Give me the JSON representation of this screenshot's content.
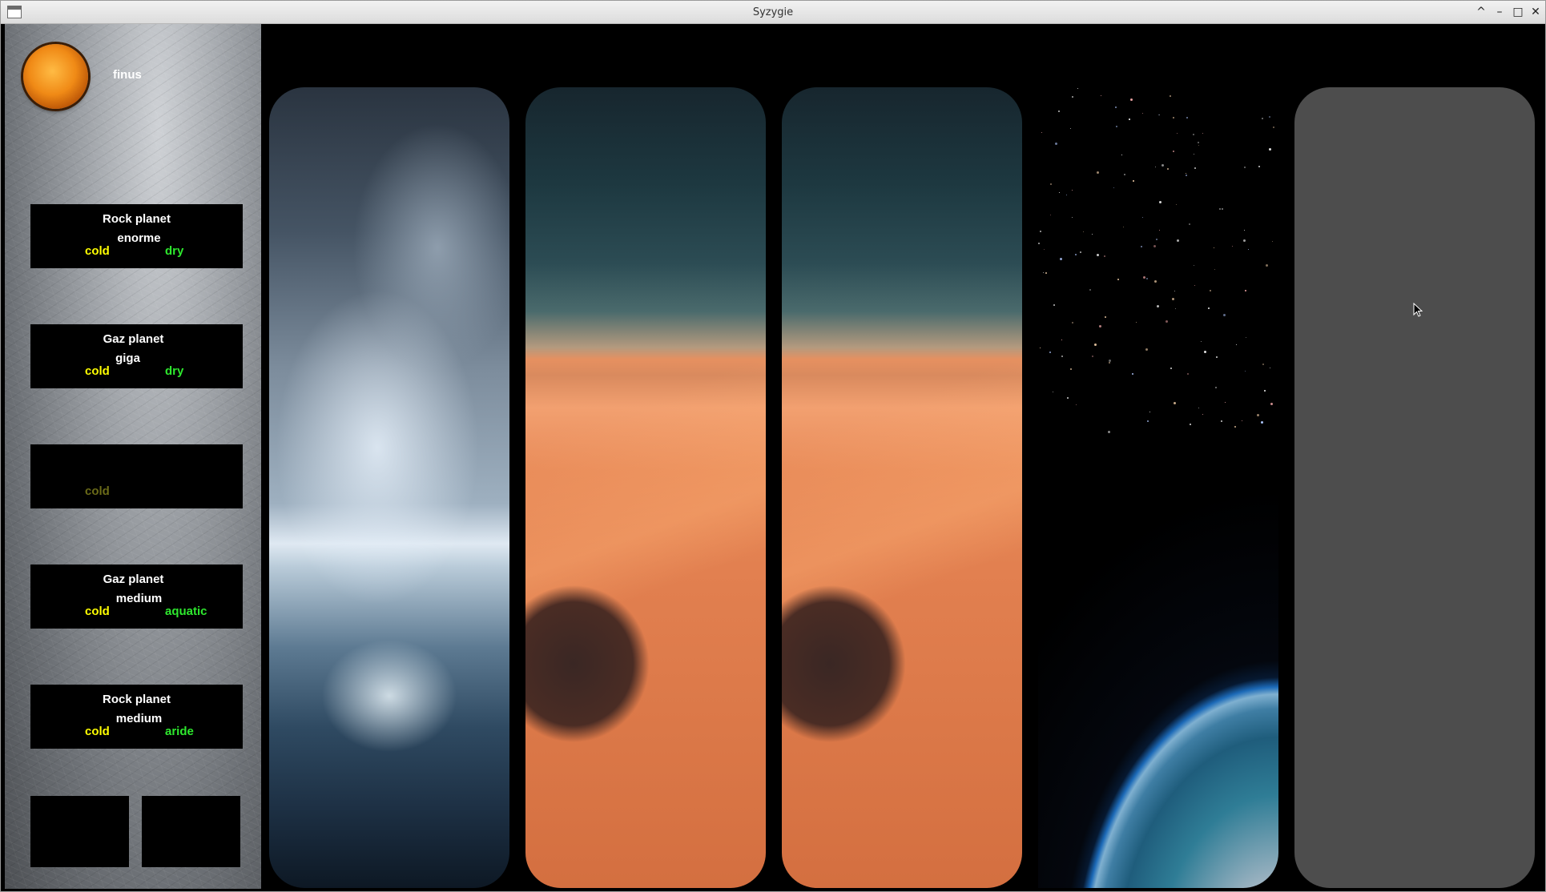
{
  "window": {
    "title": "Syzygie",
    "controls": [
      "^",
      "–",
      "□",
      "✕"
    ]
  },
  "sidebar": {
    "planet_name": "finus",
    "cards": [
      {
        "type": "Rock planet",
        "size": "enorme",
        "temp": "cold",
        "humidity": "dry"
      },
      {
        "type": "Gaz planet",
        "size": "giga",
        "temp": "cold",
        "humidity": "dry"
      },
      {
        "type": "",
        "size": "",
        "temp": "cold",
        "humidity": ""
      },
      {
        "type": "Gaz planet",
        "size": "medium",
        "temp": "cold",
        "humidity": "aquatic"
      },
      {
        "type": "Rock planet",
        "size": "medium",
        "temp": "cold",
        "humidity": "aride"
      }
    ]
  },
  "colors": {
    "temp_text": "#ffff00",
    "humidity_text": "#2ee82e",
    "card_bg": "#000000",
    "empty_panel": "#4d4d4d"
  },
  "panels": [
    {
      "name": "ocean-storm"
    },
    {
      "name": "desert"
    },
    {
      "name": "desert"
    },
    {
      "name": "earth-from-space"
    },
    {
      "name": "empty"
    }
  ]
}
